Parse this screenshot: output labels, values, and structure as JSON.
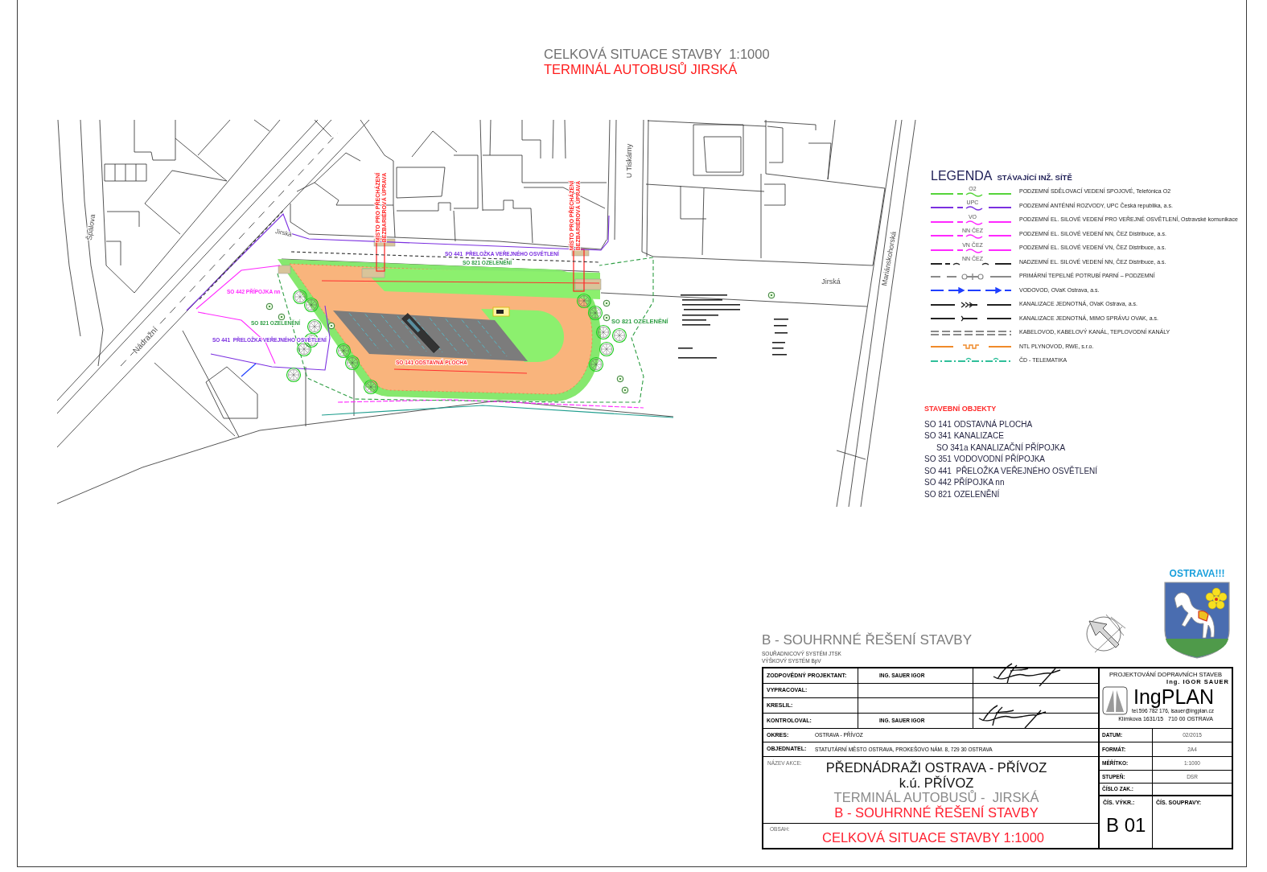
{
  "sheet_title": {
    "lines": [
      {
        "text": "CELKOVÁ SITUACE STAVBY  1:1000",
        "kind": "subtitle"
      },
      {
        "text": "TERMINÁL AUTOBUSŮ JIRSKÁ",
        "kind": "highlight"
      }
    ]
  },
  "map": {
    "streets": [
      {
        "name": "Špálova"
      },
      {
        "name": "Nádražní"
      },
      {
        "name": "Jirská"
      },
      {
        "name": "U Tiskárny"
      },
      {
        "name": "Jirská"
      },
      {
        "name": "Mariánskohorská"
      }
    ],
    "object_labels": [
      {
        "text": "SO 441  PŘELOŽKA VEŘEJNÉHO OSVĚTLENÍ",
        "color": "#7b2fe0"
      },
      {
        "text": "SO 821 OZELENĚNÍ",
        "color": "#2f9e44"
      },
      {
        "text": "SO 442 PŘÍPOJKA nn",
        "color": "#ff29ff"
      },
      {
        "text": "SO 821 OZELENĚNÍ",
        "color": "#2f9e44"
      },
      {
        "text": "SO 441  PŘELOŽKA VEŘEJNÉHO OSVĚTLENÍ",
        "color": "#7b2fe0"
      },
      {
        "text": "SO 141 ODSTAVNÁ PLOCHA",
        "color": "#ff2a2a"
      },
      {
        "text": "SO 821 OZELENĚNÍ",
        "color": "#2f9e44"
      }
    ],
    "crossing_notes": [
      {
        "lines": [
          "MÍSTO PRO PŘECHÁZENÍ",
          "BEZBARIÉROVÁ ÚPRAVA"
        ]
      },
      {
        "lines": [
          "MÍSTO PRO PŘECHÁZENÍ",
          "BEZBARIÉROVÁ ÚPRAVA"
        ]
      }
    ]
  },
  "legend": {
    "title": "LEGENDA",
    "subtitle": "STÁVAJÍCÍ INŽ. SÍTĚ",
    "items": [
      {
        "kind": "tagged",
        "color": "#55d43a",
        "tag": "O2",
        "text": "PODZEMNÍ SDĚLOVACÍ VEDENÍ SPOJOVÉ, Telefónica O2"
      },
      {
        "kind": "tagged",
        "color": "#7b2fe0",
        "tag": "UPC",
        "text": "PODZEMNÍ ANTÉNNÍ ROZVODY, UPC Česká republika, a.s."
      },
      {
        "kind": "tagged",
        "color": "#ff29ff",
        "tag": "VO",
        "text": "PODZEMNÍ EL. SILOVÉ VEDENÍ PRO VEŘEJNÉ OSVĚTLENÍ, Ostravské komunikace"
      },
      {
        "kind": "tagged",
        "color": "#ff29ff",
        "tag": "NN ČEZ",
        "text": "PODZEMNÍ EL. SILOVÉ VEDENÍ NN, ČEZ Distribuce, a.s."
      },
      {
        "kind": "tagged",
        "color": "#ff29ff",
        "tag": "VN ČEZ",
        "text": "PODZEMNÍ EL. SILOVÉ VEDENÍ VN, ČEZ Distribuce, a.s."
      },
      {
        "kind": "tagged-dashed",
        "color": "#222222",
        "tag": "NN ČEZ",
        "text": "NADZEMNÍ EL. SILOVÉ VEDENÍ NN, ČEZ Distribuce, a.s."
      },
      {
        "kind": "valve",
        "color": "#8a8a8a",
        "text": "PRIMÁRNÍ TEPELNÉ POTRUBÍ PARNÍ – PODZEMNÍ"
      },
      {
        "kind": "arrows",
        "color": "#1f3fff",
        "text": "VODOVOD, OVaK Ostrava, a.s."
      },
      {
        "kind": "chevrons",
        "color": "#222222",
        "text": "KANALIZACE JEDNOTNÁ, OVaK Ostrava, a.s."
      },
      {
        "kind": "bracket",
        "color": "#222222",
        "text": "KANALIZACE JEDNOTNÁ, MIMO SPRÁVU OVAK, a.s."
      },
      {
        "kind": "double",
        "color": "#8a8a8a",
        "text": "KABELOVOD, KABELOVÝ KANÁL, TEPLOVODNÍ KANÁLY"
      },
      {
        "kind": "gas",
        "color": "#f08a2a",
        "text": "NTL PLYNOVOD, RWE, s.r.o."
      },
      {
        "kind": "dashdot",
        "color": "#2fbf9a",
        "text": "ČD - TELEMATIKA"
      }
    ]
  },
  "building_objects": {
    "title": "STAVEBNÍ OBJEKTY",
    "items": [
      {
        "text": "SO 141 ODSTAVNÁ PLOCHA"
      },
      {
        "text": "SO 341 KANALIZACE",
        "children": [
          {
            "text": "SO 341a KANALIZAČNÍ PŘÍPOJKA"
          }
        ]
      },
      {
        "text": "SO 351 VODOVODNÍ PŘÍPOJKA"
      },
      {
        "text": "SO 441  PŘELOŽKA VEŘEJNÉHO OSVĚTLENÍ"
      },
      {
        "text": "SO 442 PŘÍPOJKA nn"
      },
      {
        "text": "SO 821 OZELENĚNÍ"
      }
    ]
  },
  "title_block": {
    "heading": "B - SOUHRNNÉ ŘEŠENÍ STAVBY",
    "coordinate_notes": [
      "SOUŘADNICOVÝ SYSTÉM JTSK",
      "VÝŠKOVÝ SYSTÉM BpV"
    ],
    "coat_of_arms_caption": "OSTRAVA!!!",
    "people": [
      {
        "role": "ZODPOVĚDNÝ PROJEKTANT:",
        "name": "ING. SAUER IGOR",
        "signed": true
      },
      {
        "role": "VYPRACOVAL:",
        "signed": false
      },
      {
        "role": "KRESLIL:",
        "signed": false
      },
      {
        "role": "KONTROLOVAL:",
        "name": "ING. SAUER IGOR",
        "signed": true
      }
    ],
    "fields": [
      {
        "label": "OKRES:",
        "value": "OSTRAVA - PŘÍVOZ"
      },
      {
        "label": "OBJEDNATEL:",
        "value": "STATUTÁRNÍ MĚSTO OSTRAVA, PROKEŠOVO NÁM. 8, 729 30 OSTRAVA"
      }
    ],
    "project": {
      "label": "NÁZEV AKCE:",
      "lines": [
        {
          "text": "PŘEDNÁDRAŽI OSTRAVA - PŘÍVOZ",
          "kind": "primary"
        },
        {
          "text": "k.ú. PŘÍVOZ",
          "kind": "primary"
        },
        {
          "text": "TERMINÁL AUTOBUSŮ -  JIRSKÁ",
          "kind": "secondary"
        },
        {
          "text": "B - SOUHRNNÉ ŘEŠENÍ STAVBY",
          "kind": "highlight"
        }
      ]
    },
    "contents": {
      "label": "OBSAH:",
      "value": "CELKOVÁ SITUACE STAVBY 1:1000"
    },
    "company": {
      "lines": [
        "PROJEKTOVÁNÍ DOPRAVNÍCH STAVEB",
        "Ing. IGOR SAUER"
      ],
      "logo_text": "IngPLAN",
      "contact": "tel.596 782 176, isauer@ingplan.cz",
      "address": "Klímkova 1631/15   710 00 OSTRAVA"
    },
    "details": [
      {
        "label": "DATUM:",
        "value": "02/2015"
      },
      {
        "label": "FORMÁT:",
        "value": "2A4"
      },
      {
        "label": "MĚŘÍTKO:",
        "value": "1:1000"
      },
      {
        "label": "STUPEŇ:",
        "value": "DSR"
      },
      {
        "label": "ČÍSLO ZAK.:"
      }
    ],
    "drawing_number": {
      "label": "ČÍS. VÝKR.:",
      "value": "B 01"
    },
    "set_number": {
      "label": "ČÍS. SOUPRAVY:"
    }
  }
}
